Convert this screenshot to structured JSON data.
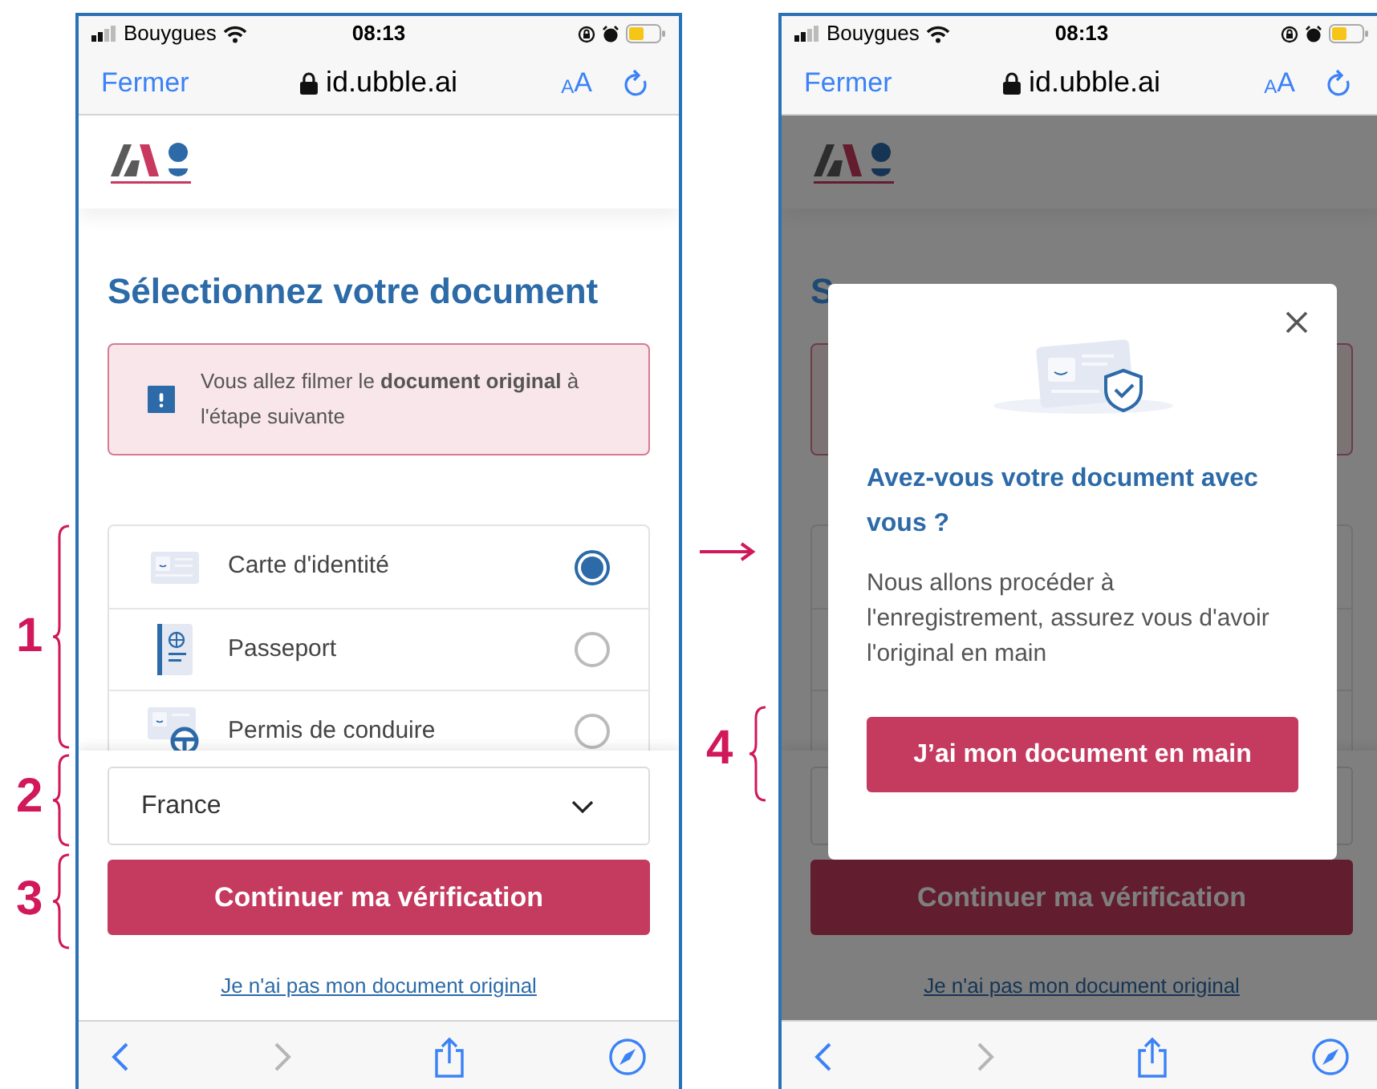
{
  "screens": [
    {
      "status_bar": {
        "carrier": "Bouygues",
        "time": "08:13"
      },
      "browser": {
        "close": "Fermer",
        "url": "id.ubble.ai",
        "text_size": "AA",
        "forward_disabled": true
      },
      "page": {
        "heading": "Sélectionnez votre document",
        "notice": "Vous allez filmer le **document original** à l'étape suivante",
        "documents": [
          {
            "kind": "id_card",
            "label": "Carte d'identité",
            "selected": true
          },
          {
            "kind": "passport",
            "label": "Passeport",
            "selected": false
          },
          {
            "kind": "license",
            "label": "Permis de conduire",
            "selected": false
          }
        ],
        "country": "France",
        "continue": "Continuer ma vérification",
        "no_document_link": "Je n'ai pas mon document original"
      }
    },
    {
      "status_bar": {
        "carrier": "Bouygues",
        "time": "08:13"
      },
      "browser": {
        "close": "Fermer",
        "url": "id.ubble.ai",
        "text_size": "AA",
        "forward_disabled": true
      },
      "page": {
        "heading": "S",
        "continue": "Continuer ma vérification",
        "no_document_link": "Je n'ai pas mon document original"
      },
      "modal": {
        "title": "Avez-vous votre document avec vous ?",
        "body": "Nous allons procéder à l'enregistrement, assurez vous d'avoir l'original en main",
        "button": "J’ai mon document en main"
      }
    }
  ],
  "annotations": [
    {
      "label": "1"
    },
    {
      "label": "2"
    },
    {
      "label": "3"
    },
    {
      "label": "4"
    }
  ]
}
